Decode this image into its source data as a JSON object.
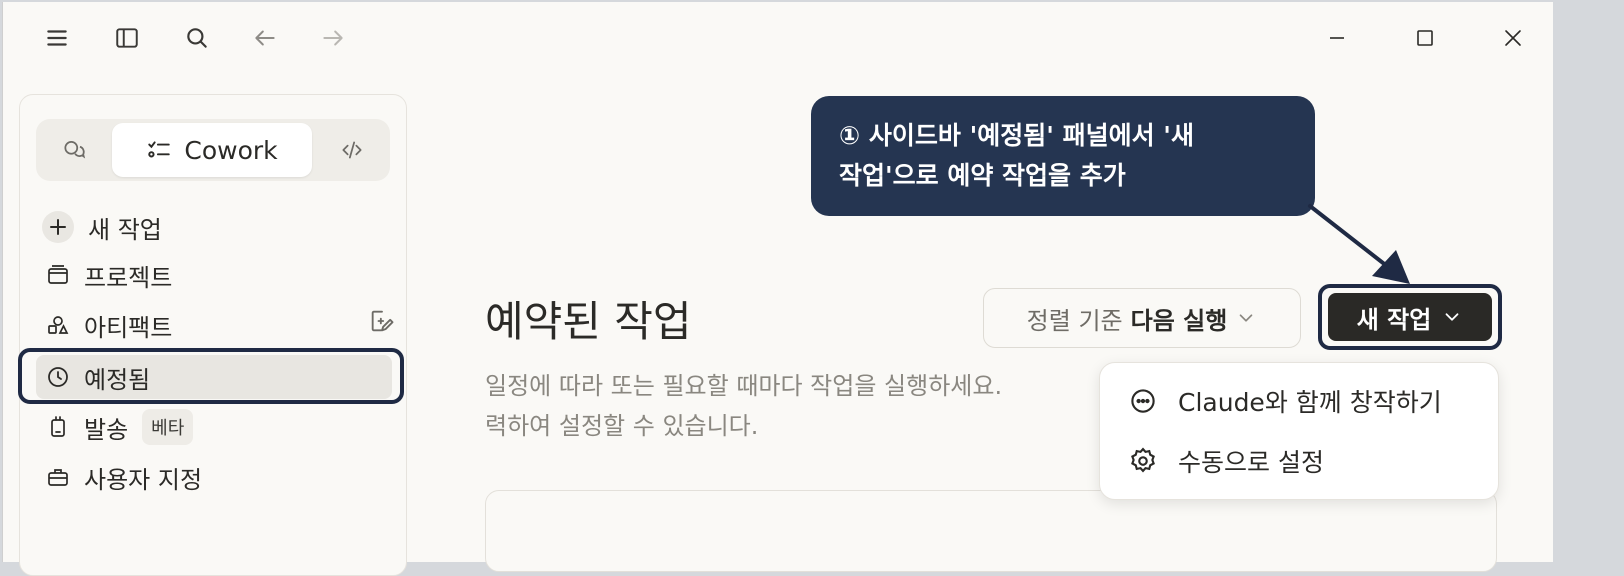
{
  "sidebar": {
    "mode_cowork": "Cowork",
    "items": [
      {
        "label": "새 작업"
      },
      {
        "label": "프로젝트"
      },
      {
        "label": "아티팩트"
      },
      {
        "label": "예정됨"
      },
      {
        "label": "발송",
        "badge": "베타"
      },
      {
        "label": "사용자 지정"
      }
    ]
  },
  "main": {
    "title": "예약된 작업",
    "subtitle_line1": "일정에 따라 또는 필요할 때마다 작업을 실행하세요.",
    "subtitle_line2": "력하여 설정할 수 있습니다.",
    "sort_prefix": "정렬 기준",
    "sort_value": "다음 실행",
    "new_task_label": "새 작업",
    "dropdown": [
      {
        "label": "Claude와 함께 창작하기",
        "icon": "chat-bubble-icon"
      },
      {
        "label": "수동으로 설정",
        "icon": "gear-icon"
      }
    ]
  },
  "callout": {
    "line1": "① 사이드바 '예정됨' 패널에서 '새",
    "line2": "작업'으로 예약 작업을 추가"
  },
  "colors": {
    "callout_bg": "#253551",
    "highlight_border": "#1f2a44",
    "primary_button": "#2a2926"
  }
}
